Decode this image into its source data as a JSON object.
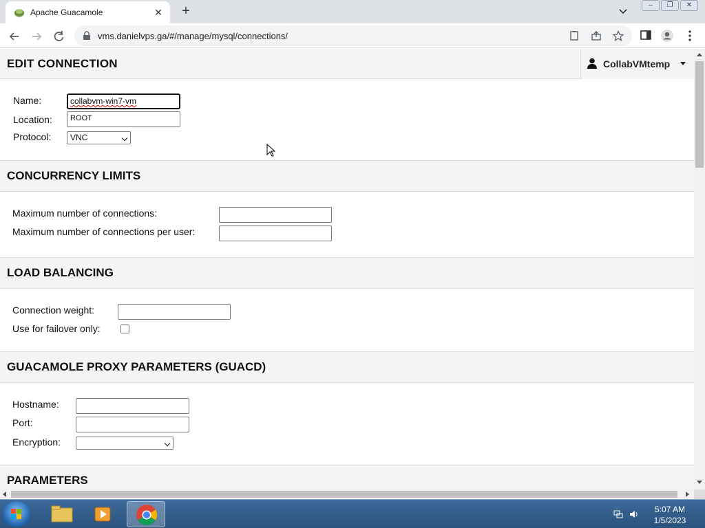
{
  "browser": {
    "tab_title": "Apache Guacamole",
    "tab_close": "✕",
    "new_tab": "+",
    "url": "vms.danielvps.ga/#/manage/mysql/connections/",
    "window_buttons": [
      "–",
      "❐",
      "✕"
    ]
  },
  "header": {
    "title": "EDIT CONNECTION",
    "user": "CollabVMtemp"
  },
  "connection": {
    "name_label": "Name:",
    "name_value": "collabvm-win7-vm",
    "location_label": "Location:",
    "location_value": "ROOT",
    "protocol_label": "Protocol:",
    "protocol_value": "VNC"
  },
  "concurrency": {
    "title": "CONCURRENCY LIMITS",
    "max_connections_label": "Maximum number of connections:",
    "max_connections_value": "",
    "max_per_user_label": "Maximum number of connections per user:",
    "max_per_user_value": ""
  },
  "load_balancing": {
    "title": "LOAD BALANCING",
    "weight_label": "Connection weight:",
    "weight_value": "",
    "failover_label": "Use for failover only:",
    "failover_checked": false
  },
  "guacd": {
    "title": "GUACAMOLE PROXY PARAMETERS (GUACD)",
    "hostname_label": "Hostname:",
    "hostname_value": "",
    "port_label": "Port:",
    "port_value": "",
    "encryption_label": "Encryption:",
    "encryption_value": ""
  },
  "parameters": {
    "title": "PARAMETERS"
  },
  "taskbar": {
    "time": "5:07 AM",
    "date": "1/5/2023"
  },
  "colors": {
    "header_bg": "#f4f4f4",
    "chrome_tabstrip": "#dee1e6",
    "taskbar": "#2a527e"
  }
}
